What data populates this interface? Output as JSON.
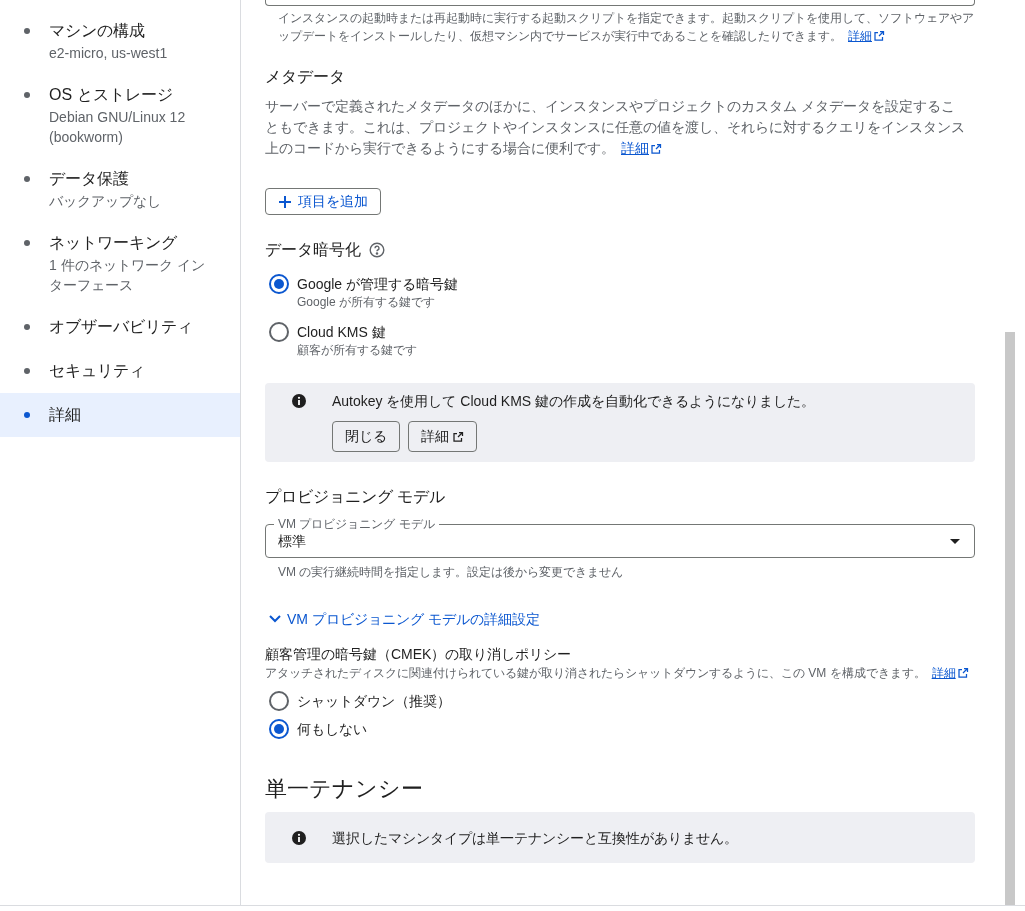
{
  "sidebar": {
    "items": [
      {
        "title": "マシンの構成",
        "subtitle": "e2-micro, us-west1",
        "selected": false
      },
      {
        "title": "OS とストレージ",
        "subtitle": "Debian GNU/Linux 12 (bookworm)",
        "selected": false
      },
      {
        "title": "データ保護",
        "subtitle": "バックアップなし",
        "selected": false
      },
      {
        "title": "ネットワーキング",
        "subtitle": "1 件のネットワーク インターフェース",
        "selected": false
      },
      {
        "title": "オブザーバビリティ",
        "selected": false
      },
      {
        "title": "セキュリティ",
        "selected": false
      },
      {
        "title": "詳細",
        "selected": true
      }
    ]
  },
  "startup_script": {
    "helper": "インスタンスの起動時または再起動時に実行する起動スクリプトを指定できます。起動スクリプトを使用して、ソフトウェアやアップデートをインストールしたり、仮想マシン内でサービスが実行中であることを確認したりできます。",
    "link": "詳細"
  },
  "metadata": {
    "heading": "メタデータ",
    "description": "サーバーで定義されたメタデータのほかに、インスタンスやプロジェクトのカスタム メタデータを設定することもできます。これは、プロジェクトやインスタンスに任意の値を渡し、それらに対するクエリをインスタンス上のコードから実行できるようにする場合に便利です。",
    "link": "詳細",
    "add_button": "項目を追加"
  },
  "encryption": {
    "heading": "データ暗号化",
    "options": [
      {
        "label": "Google が管理する暗号鍵",
        "hint": "Google が所有する鍵です",
        "selected": true
      },
      {
        "label": "Cloud KMS 鍵",
        "hint": "顧客が所有する鍵です",
        "selected": false
      }
    ],
    "notice": {
      "text": "Autokey を使用して Cloud KMS 鍵の作成を自動化できるようになりました。",
      "close_button": "閉じる",
      "details_button": "詳細"
    }
  },
  "provisioning": {
    "heading": "プロビジョニング モデル",
    "select": {
      "label": "VM プロビジョニング モデル",
      "value": "標準"
    },
    "helper": "VM の実行継続時間を指定します。設定は後から変更できません",
    "advanced_toggle": "VM プロビジョニング モデルの詳細設定",
    "policy": {
      "heading": "顧客管理の暗号鍵（CMEK）の取り消しポリシー",
      "description": "アタッチされたディスクに関連付けられている鍵が取り消されたらシャットダウンするように、この VM を構成できます。",
      "link": "詳細",
      "options": [
        {
          "label": "シャットダウン（推奨）",
          "selected": false
        },
        {
          "label": "何もしない",
          "selected": true
        }
      ]
    }
  },
  "sole_tenancy": {
    "heading": "単一テナンシー",
    "notice": "選択したマシンタイプは単一テナンシーと互換性がありません。"
  }
}
